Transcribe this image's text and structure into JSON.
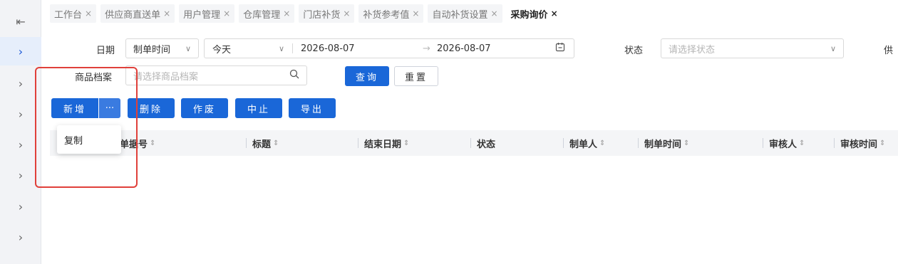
{
  "tabs": [
    {
      "label": "工作台",
      "close": "×",
      "active": false
    },
    {
      "label": "供应商直送单",
      "close": "×",
      "active": false
    },
    {
      "label": "用户管理",
      "close": "×",
      "active": false
    },
    {
      "label": "仓库管理",
      "close": "×",
      "active": false
    },
    {
      "label": "门店补货",
      "close": "×",
      "active": false
    },
    {
      "label": "补货参考值",
      "close": "×",
      "active": false
    },
    {
      "label": "自动补货设置",
      "close": "×",
      "active": false
    },
    {
      "label": "采购询价",
      "close": "×",
      "active": true
    }
  ],
  "filters": {
    "date_label": "日期",
    "date_type": "制单时间",
    "quick_range": "今天",
    "start_date": "2026-08-07",
    "range_arrow": "→",
    "end_date": "2026-08-07",
    "status_label": "状态",
    "status_placeholder": "请选择状态",
    "cut_label": "供",
    "product_label": "商品档案",
    "product_placeholder": "请选择商品档案",
    "search_button": "查询",
    "reset_button": "重置"
  },
  "toolbar": {
    "add": "新增",
    "more": "···",
    "delete": "删除",
    "void": "作废",
    "stop": "中止",
    "export": "导出"
  },
  "dropdown": {
    "copy": "复制"
  },
  "table": {
    "columns": [
      "单据号",
      "标题",
      "结束日期",
      "状态",
      "制单人",
      "制单时间",
      "审核人",
      "审核时间"
    ],
    "sort_icon": "⇕"
  }
}
